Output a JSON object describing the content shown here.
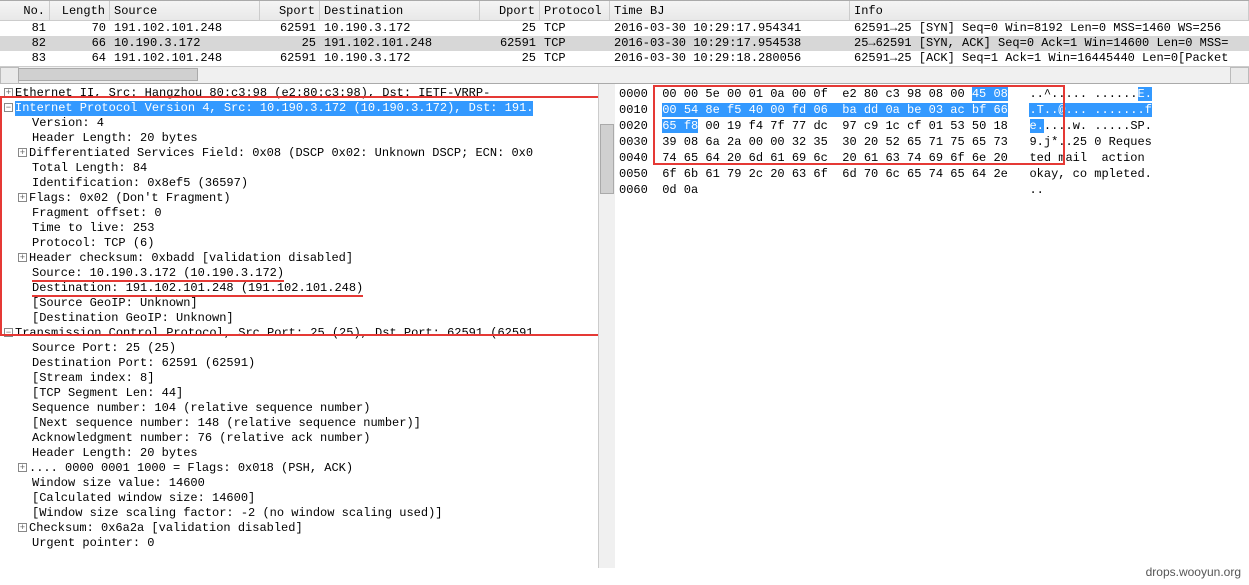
{
  "columns": [
    "No.",
    "Length",
    "Source",
    "Sport",
    "Destination",
    "Dport",
    "Protocol",
    "Time BJ",
    "Info"
  ],
  "packets": [
    {
      "no": "81",
      "len": "70",
      "src": "191.102.101.248",
      "sport": "62591",
      "dst": "10.190.3.172",
      "dport": "25",
      "proto": "TCP",
      "time": "2016-03-30 10:29:17.954341",
      "info": "62591→25 [SYN] Seq=0 Win=8192 Len=0 MSS=1460 WS=256",
      "sel": false
    },
    {
      "no": "82",
      "len": "66",
      "src": "10.190.3.172",
      "sport": "25",
      "dst": "191.102.101.248",
      "dport": "62591",
      "proto": "TCP",
      "time": "2016-03-30 10:29:17.954538",
      "info": "25→62591 [SYN, ACK] Seq=0 Ack=1 Win=14600 Len=0 MSS=",
      "sel": true
    },
    {
      "no": "83",
      "len": "64",
      "src": "191.102.101.248",
      "sport": "62591",
      "dst": "10.190.3.172",
      "dport": "25",
      "proto": "TCP",
      "time": "2016-03-30 10:29:18.280056",
      "info": "62591→25 [ACK] Seq=1 Ack=1 Win=16445440 Len=0[Packet",
      "sel": false
    }
  ],
  "detail": {
    "eth": "Ethernet II, Src: Hangzhou_80:c3:98 (e2:80:c3:98), Dst: IETF-VRRP-",
    "ip": {
      "hdr": "Internet Protocol Version 4, Src: 10.190.3.172 (10.190.3.172), Dst: 191.",
      "ver": "Version: 4",
      "hlen": "Header Length: 20 bytes",
      "dscp": "Differentiated Services Field: 0x08 (DSCP 0x02: Unknown DSCP; ECN: 0x0",
      "tlen": "Total Length: 84",
      "id": "Identification: 0x8ef5 (36597)",
      "flags": "Flags: 0x02 (Don't Fragment)",
      "frag": "Fragment offset: 0",
      "ttl": "Time to live: 253",
      "proto": "Protocol: TCP (6)",
      "chk": "Header checksum: 0xbadd [validation disabled]",
      "src": "Source: 10.190.3.172 (10.190.3.172)",
      "dst": "Destination: 191.102.101.248 (191.102.101.248)",
      "geoip_s": "[Source GeoIP: Unknown]",
      "geoip_d": "[Destination GeoIP: Unknown]"
    },
    "tcp": {
      "hdr": "Transmission Control Protocol, Src Port: 25 (25), Dst Port: 62591 (62591",
      "sport": "Source Port: 25 (25)",
      "dport": "Destination Port: 62591 (62591)",
      "stream": "[Stream index: 8]",
      "seglen": "[TCP Segment Len: 44]",
      "seq": "Sequence number: 104    (relative sequence number)",
      "nseq": "[Next sequence number: 148    (relative sequence number)]",
      "ack": "Acknowledgment number: 76    (relative ack number)",
      "hlen": "Header Length: 20 bytes",
      "flags": ".... 0000 0001 1000 = Flags: 0x018 (PSH, ACK)",
      "win": "Window size value: 14600",
      "cwin": "[Calculated window size: 14600]",
      "wscale": "[Window size scaling factor: -2 (no window scaling used)]",
      "chk": "Checksum: 0x6a2a [validation disabled]",
      "urg": "Urgent pointer: 0"
    }
  },
  "hex": {
    "rows": [
      {
        "off": "0000",
        "b": "00 00 5e 00 01 0a 00 0f  e2 80 c3 98 08 00 ",
        "hl": "45 08",
        "a": " ..^..... ......",
        "ahl": "E."
      },
      {
        "off": "0010",
        "hl": "00 54 8e f5 40 00 fd 06  ba dd 0a be 03 ac bf 66",
        "b": "",
        "a": " ",
        "ahlpre": ".T..@... .......f",
        "ahl": ""
      },
      {
        "off": "0020",
        "hl": "65 f8",
        "b": " 00 19 f4 7f 77 dc  97 c9 1c cf 01 53 50 18",
        "a": " ",
        "ahlpre": "e.",
        "arest": "....w. .....SP."
      },
      {
        "off": "0030",
        "b": "39 08 6a 2a 00 00 32 35  30 20 52 65 71 75 65 73",
        "a": " 9.j*..25 0 Reques"
      },
      {
        "off": "0040",
        "b": "74 65 64 20 6d 61 69 6c  20 61 63 74 69 6f 6e 20",
        "a": " ted mail  action "
      },
      {
        "off": "0050",
        "b": "6f 6b 61 79 2c 20 63 6f  6d 70 6c 65 74 65 64 2e",
        "a": " okay, co mpleted."
      },
      {
        "off": "0060",
        "b": "0d 0a",
        "a": " .."
      }
    ]
  },
  "watermark": "drops.wooyun.org"
}
